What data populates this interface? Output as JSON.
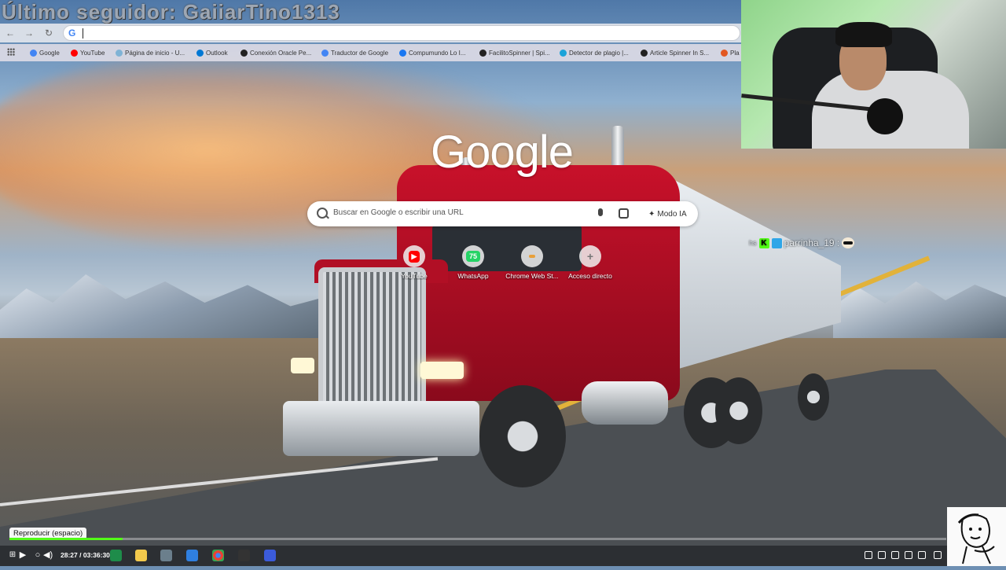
{
  "overlay": {
    "banner_text": "Último seguidor: GaiiarTino1313"
  },
  "browser": {
    "omnibox_value": "",
    "bookmarks": [
      {
        "label": "Google",
        "color": "#4285f4"
      },
      {
        "label": "YouTube",
        "color": "#ff0000"
      },
      {
        "label": "Página de inicio - U...",
        "color": "#7fb3d5"
      },
      {
        "label": "Outlook",
        "color": "#0078d4"
      },
      {
        "label": "Conexión Oracle Pe...",
        "color": "#222222"
      },
      {
        "label": "Traductor de Google",
        "color": "#4285f4"
      },
      {
        "label": "Compumundo Lo I...",
        "color": "#1877f2"
      },
      {
        "label": "FacilitoSpinner | Spi...",
        "color": "#222222"
      },
      {
        "label": "Detector de plagio |...",
        "color": "#1aa3d9"
      },
      {
        "label": "Article Spinner In S...",
        "color": "#222222"
      },
      {
        "label": "Pla",
        "color": "#e25822"
      }
    ]
  },
  "newtab": {
    "logo_text": "Google",
    "search_placeholder": "Buscar en Google o escribir una URL",
    "ai_mode_label": "Modo IA",
    "shortcuts": [
      {
        "label": "YouTube",
        "icon_text": "▶",
        "color": "#ff0000"
      },
      {
        "label": "WhatsApp",
        "icon_text": "75",
        "color": "#25d366"
      },
      {
        "label": "Chrome Web St...",
        "icon_text": "",
        "color": "#e8a03a"
      },
      {
        "label": "Acceso directo",
        "icon_text": "+",
        "color": "#777777"
      }
    ]
  },
  "chat": {
    "prefix": "hs",
    "username": "parrinha_19 :"
  },
  "player": {
    "tooltip": "Reproducir (espacio)",
    "time_current": "28:27",
    "time_separator": "/",
    "time_total": "03:36:30",
    "progress_fraction": 0.121,
    "accent": "#53fc18"
  }
}
